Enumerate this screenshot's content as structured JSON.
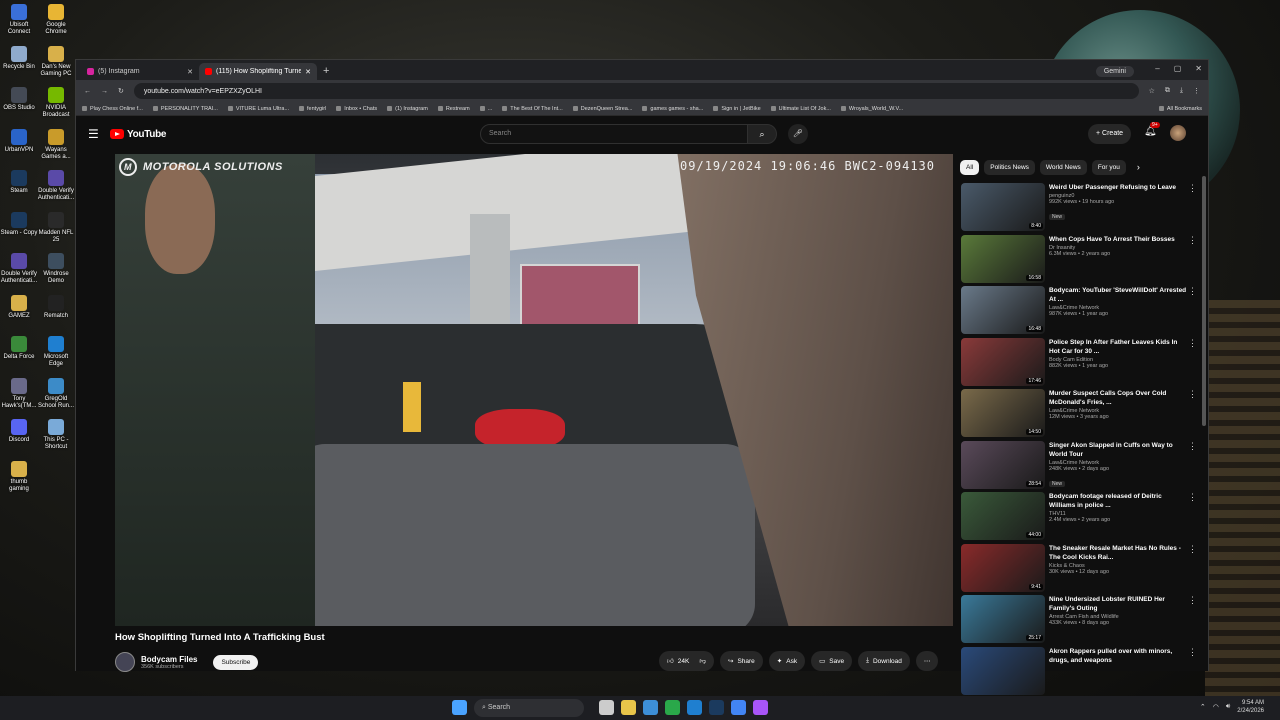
{
  "desktop": {
    "icons": [
      {
        "label": "Ubisoft Connect",
        "color": "#3a6fd8"
      },
      {
        "label": "Google Chrome",
        "color": "#e8b534"
      },
      {
        "label": "Recycle Bin",
        "color": "#8faacc"
      },
      {
        "label": "Dan's New Gaming PC",
        "color": "#d8b04a"
      },
      {
        "label": "OBS Studio",
        "color": "#444a55"
      },
      {
        "label": "NVIDIA Broadcast",
        "color": "#76b900"
      },
      {
        "label": "UrbanVPN",
        "color": "#2a64c9"
      },
      {
        "label": "Wayans Games a...",
        "color": "#c99b2a"
      },
      {
        "label": "Steam",
        "color": "#1b3a5e"
      },
      {
        "label": "Double Verify Authenticati...",
        "color": "#5a4aa8"
      },
      {
        "label": "Steam - Copy",
        "color": "#1b3a5e"
      },
      {
        "label": "Madden NFL 25",
        "color": "#2a2a2a"
      },
      {
        "label": "Double Verify Authenticati...",
        "color": "#5a4aa8"
      },
      {
        "label": "Windrose Demo",
        "color": "#3d4e5f"
      },
      {
        "label": "GAMEZ",
        "color": "#d8b04a"
      },
      {
        "label": "Rematch",
        "color": "#222222"
      },
      {
        "label": "Delta Force",
        "color": "#3a8a3a"
      },
      {
        "label": "Microsoft Edge",
        "color": "#1f7fd0"
      },
      {
        "label": "Tony Hawk's(TM...",
        "color": "#6a6a8a"
      },
      {
        "label": "GregOld School Run...",
        "color": "#3c8bc8"
      },
      {
        "label": "Discord",
        "color": "#5865f2"
      },
      {
        "label": "This PC - Shortcut",
        "color": "#7aaad8"
      },
      {
        "label": "thumb gaming",
        "color": "#d8b04a"
      }
    ]
  },
  "browser": {
    "tabs": [
      {
        "title": "(5) Instagram",
        "color": "#d6249f",
        "active": false
      },
      {
        "title": "(115) How Shoplifting Turne...",
        "color": "#ff0000",
        "active": true
      }
    ],
    "new_tab_glyph": "+",
    "gemini_label": "Gemini",
    "url": "youtube.com/watch?v=eEPZXZyOLHI",
    "bookmarks": [
      "Play Chess Online f...",
      "PERSONALITY TRAI...",
      "VITURE Luma Ultra...",
      "fentygirl",
      "Inbox • Chats",
      "(1) Instagram",
      "Restream",
      "...",
      "The Best Of The Int...",
      "DezenQueen Strea...",
      "games games - sha...",
      "Sign in | JetBike",
      "Ultimate List Of Jok...",
      "Wroyals_World_W.V...",
      "All Bookmarks"
    ]
  },
  "youtube": {
    "logo_text": "YouTube",
    "search_placeholder": "Search",
    "create_label": "Create",
    "notif_count": "9+",
    "video": {
      "overlay_brand": "MOTOROLA SOLUTIONS",
      "timestamp": "09/19/2024 19:06:46 BWC2-094130",
      "title": "How Shoplifting Turned Into A Trafficking Bust",
      "channel": "Bodycam Files",
      "subscribers": "356K subscribers",
      "subscribe_label": "Subscribe",
      "likes": "24K",
      "share_label": "Share",
      "ask_label": "Ask",
      "save_label": "Save",
      "download_label": "Download"
    },
    "chips": [
      "All",
      "Politics News",
      "World News",
      "For you"
    ],
    "recommendations": [
      {
        "title": "Weird Uber Passenger Refusing to Leave",
        "channel": "penguinz0",
        "views": "992K views • 19 hours ago",
        "duration": "8:40",
        "badge": "New",
        "color": "#4a5a6a"
      },
      {
        "title": "When Cops Have To Arrest Their Bosses",
        "channel": "Dr Insanity",
        "views": "6.3M views • 2 years ago",
        "duration": "16:58",
        "badge": "",
        "color": "#5a7a3a"
      },
      {
        "title": "Bodycam: YouTuber 'SteveWillDoIt' Arrested At ...",
        "channel": "Law&Crime Network",
        "views": "987K views • 1 year ago",
        "duration": "16:48",
        "badge": "",
        "color": "#6a7a8a"
      },
      {
        "title": "Police Step In After Father Leaves Kids In Hot Car for 30 ...",
        "channel": "Body Cam Edition",
        "views": "882K views • 1 year ago",
        "duration": "17:46",
        "badge": "",
        "color": "#8a3a3a"
      },
      {
        "title": "Murder Suspect Calls Cops Over Cold McDonald's Fries, ...",
        "channel": "Law&Crime Network",
        "views": "12M views • 3 years ago",
        "duration": "14:50",
        "badge": "",
        "color": "#7a6a4a"
      },
      {
        "title": "Singer Akon Slapped in Cuffs on Way to World Tour",
        "channel": "Law&Crime Network",
        "views": "248K views • 2 days ago",
        "duration": "28:54",
        "badge": "New",
        "color": "#5a4a5a"
      },
      {
        "title": "Bodycam footage released of Deitric Williams in police ...",
        "channel": "THV11",
        "views": "2.4M views • 2 years ago",
        "duration": "44:00",
        "badge": "",
        "color": "#3a5a3a"
      },
      {
        "title": "The Sneaker Resale Market Has No Rules - The Cool Kicks Rai...",
        "channel": "Kicks & Chaos",
        "views": "30K views • 12 days ago",
        "duration": "9:41",
        "badge": "",
        "color": "#8a2a2a"
      },
      {
        "title": "Nine Undersized Lobster RUINED Her Family's Outing",
        "channel": "Arrest Cam Fish and Wildlife",
        "views": "433K views • 8 days ago",
        "duration": "25:17",
        "badge": "",
        "color": "#3a7a9a"
      },
      {
        "title": "Akron Rappers pulled over with minors, drugs, and weapons",
        "channel": "",
        "views": "",
        "duration": "",
        "badge": "",
        "color": "#2a4a7a"
      }
    ]
  },
  "taskbar": {
    "search_placeholder": "Search",
    "time": "9:54 AM",
    "date": "2/24/2026",
    "app_colors": [
      "#cccccc",
      "#e8c54a",
      "#3d8fd8",
      "#2aa84a",
      "#1f7fd0",
      "#1b3a5e",
      "#4285f4",
      "#a855f7"
    ]
  }
}
